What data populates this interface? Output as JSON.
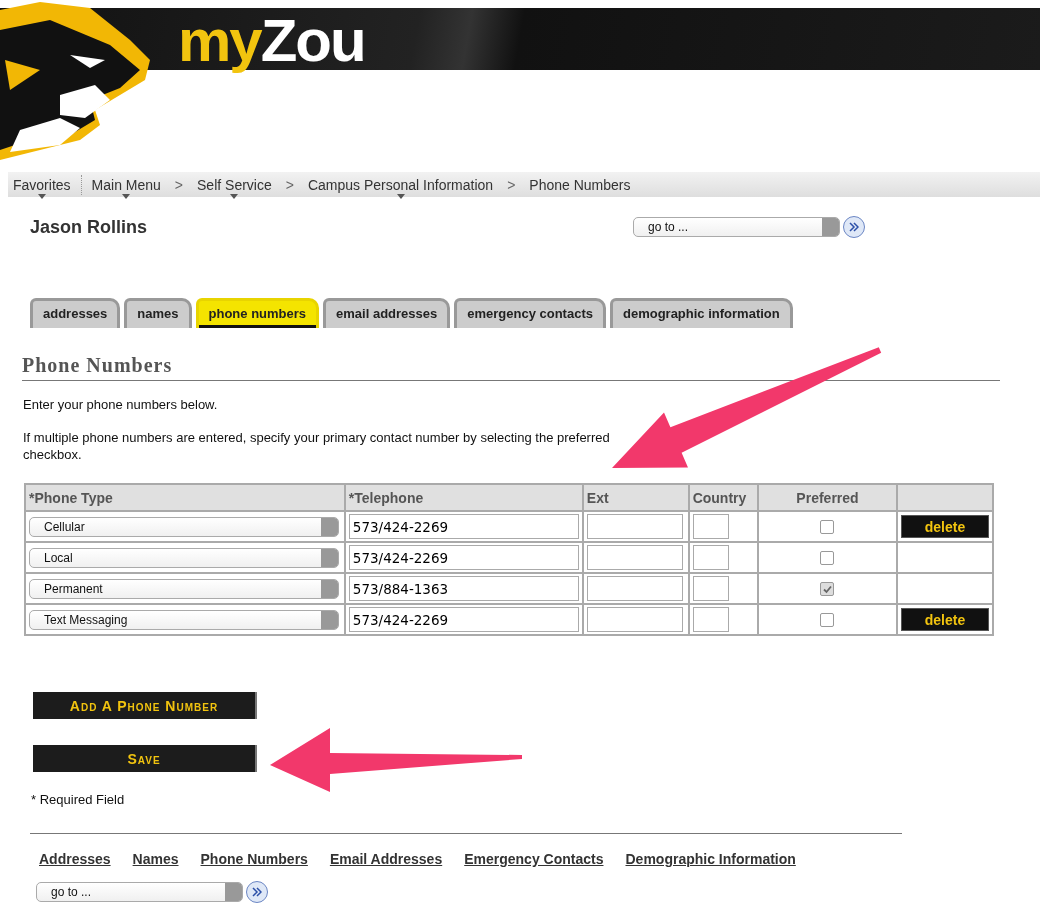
{
  "header": {
    "logo_prefix": "my",
    "logo_name": "Zou"
  },
  "breadcrumb": [
    {
      "label": "Favorites",
      "dropdown": true
    },
    {
      "label": "Main Menu",
      "dropdown": true
    },
    {
      "label": "Self Service",
      "dropdown": true,
      "separator": ">"
    },
    {
      "label": "Campus Personal Information",
      "dropdown": true,
      "separator": ">"
    },
    {
      "label": "Phone Numbers",
      "dropdown": false,
      "separator": ">"
    }
  ],
  "user_name": "Jason Rollins",
  "goto_top": {
    "value": "go to ..."
  },
  "tabs": [
    {
      "label": "addresses",
      "selected": false
    },
    {
      "label": "names",
      "selected": false
    },
    {
      "label": "phone numbers",
      "selected": true
    },
    {
      "label": "email addresses",
      "selected": false
    },
    {
      "label": "emergency contacts",
      "selected": false
    },
    {
      "label": "demographic information",
      "selected": false
    }
  ],
  "heading": "Phone Numbers",
  "intro": "Enter your phone numbers below.",
  "instructions": "If multiple phone numbers are entered, specify your primary contact number by selecting the preferred checkbox.",
  "table": {
    "columns": [
      "*Phone Type",
      "*Telephone",
      "Ext",
      "Country",
      "Preferred"
    ],
    "rows": [
      {
        "phone_type": "Cellular",
        "telephone": "573/424-2269",
        "preferred": false,
        "delete": "delete"
      },
      {
        "phone_type": "Local",
        "telephone": "573/424-2269",
        "preferred": false
      },
      {
        "phone_type": "Permanent",
        "telephone": "573/884-1363",
        "preferred": true
      },
      {
        "phone_type": "Text Messaging",
        "telephone": "573/424-2269",
        "preferred": false,
        "delete": "delete"
      }
    ]
  },
  "add_button": "Add A Phone Number",
  "save_button": "Save",
  "required_note": "* Required Field",
  "footer_links": [
    "Addresses",
    "Names",
    "Phone Numbers",
    "Email Addresses",
    "Emergency Contacts",
    "Demographic Information"
  ],
  "goto_bottom": {
    "value": "go to ..."
  }
}
